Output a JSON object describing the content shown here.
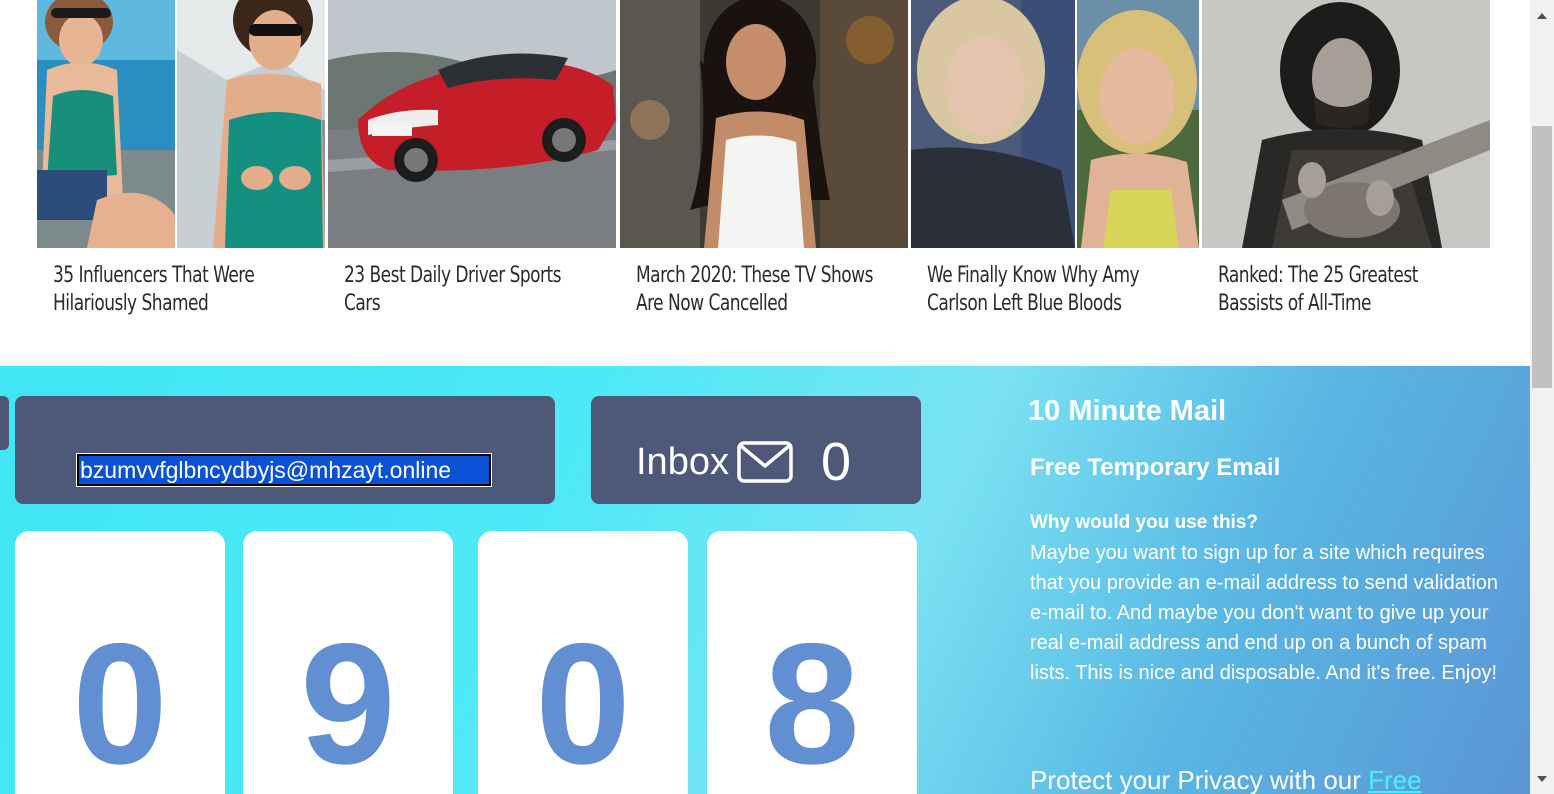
{
  "promos": [
    {
      "title": "35 Influencers That Were Hilariously Shamed",
      "image": "two-women-swimsuits-photo"
    },
    {
      "title": "23 Best Daily Driver Sports Cars",
      "image": "red-sports-car-photo"
    },
    {
      "title": "March 2020: These TV Shows Are Now Cancelled",
      "image": "actress-tank-top-photo"
    },
    {
      "title": "We Finally Know Why Amy Carlson Left Blue Bloods",
      "image": "blonde-woman-portraits-photo"
    },
    {
      "title": "Ranked: The 25 Greatest Bassists of All-Time",
      "image": "bassist-guitar-photo"
    }
  ],
  "mail": {
    "address": "bzumvvfglbncydbyjs@mhzayt.online",
    "inbox_label": "Inbox",
    "inbox_count": "0",
    "timer_digits": [
      "0",
      "9",
      "0",
      "8"
    ]
  },
  "info": {
    "brand": "10 Minute Mail",
    "subtitle": "Free Temporary Email",
    "why_heading": "Why would you use this?",
    "body": "Maybe you want to sign up for a site which requires that you provide an e-mail address to send validation e-mail to. And maybe you don't want to give up your real e-mail address and end up on a bunch of spam lists. This is nice and disposable. And it's free. Enjoy!",
    "protect_text": "Protect your Privacy with our",
    "protect_link": "Free"
  },
  "colors": {
    "panel": "#4e5879",
    "digit": "#628fd2",
    "link": "#42f4ff",
    "selection": "#0b51d6"
  },
  "icons": [
    "envelope-icon",
    "scroll-up-arrow-icon",
    "scroll-down-arrow-icon"
  ]
}
